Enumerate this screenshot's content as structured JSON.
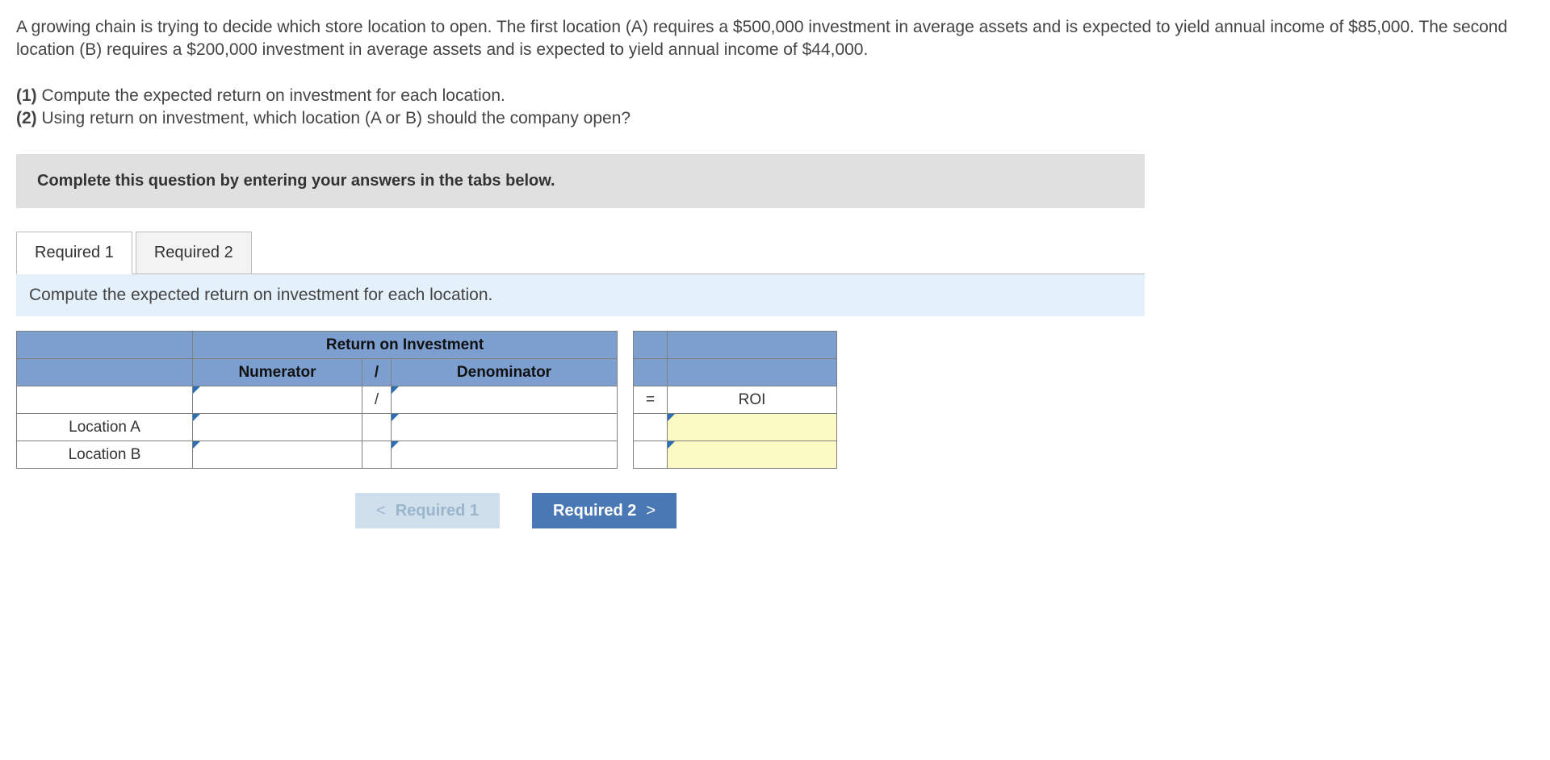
{
  "problem": {
    "text": "A growing chain is trying to decide which store location to open. The first location (A) requires a $500,000 investment in average assets and is expected to yield annual income of $85,000. The second location (B) requires a $200,000 investment in average assets and is expected to yield annual income of $44,000."
  },
  "questions": {
    "q1_num": "(1)",
    "q1_text": " Compute the expected return on investment for each location.",
    "q2_num": "(2)",
    "q2_text": " Using return on investment, which location (A or B) should the company open?"
  },
  "instruction": "Complete this question by entering your answers in the tabs below.",
  "tabs": {
    "t1": "Required 1",
    "t2": "Required 2"
  },
  "tab_content_heading": "Compute the expected return on investment for each location.",
  "table": {
    "main_header": "Return on Investment",
    "numerator": "Numerator",
    "slash": "/",
    "denominator": "Denominator",
    "slash2": "/",
    "equals": "=",
    "roi": "ROI",
    "row_a": "Location A",
    "row_b": "Location B"
  },
  "nav": {
    "prev_chev": "<",
    "prev": "Required 1",
    "next": "Required 2",
    "next_chev": ">"
  }
}
